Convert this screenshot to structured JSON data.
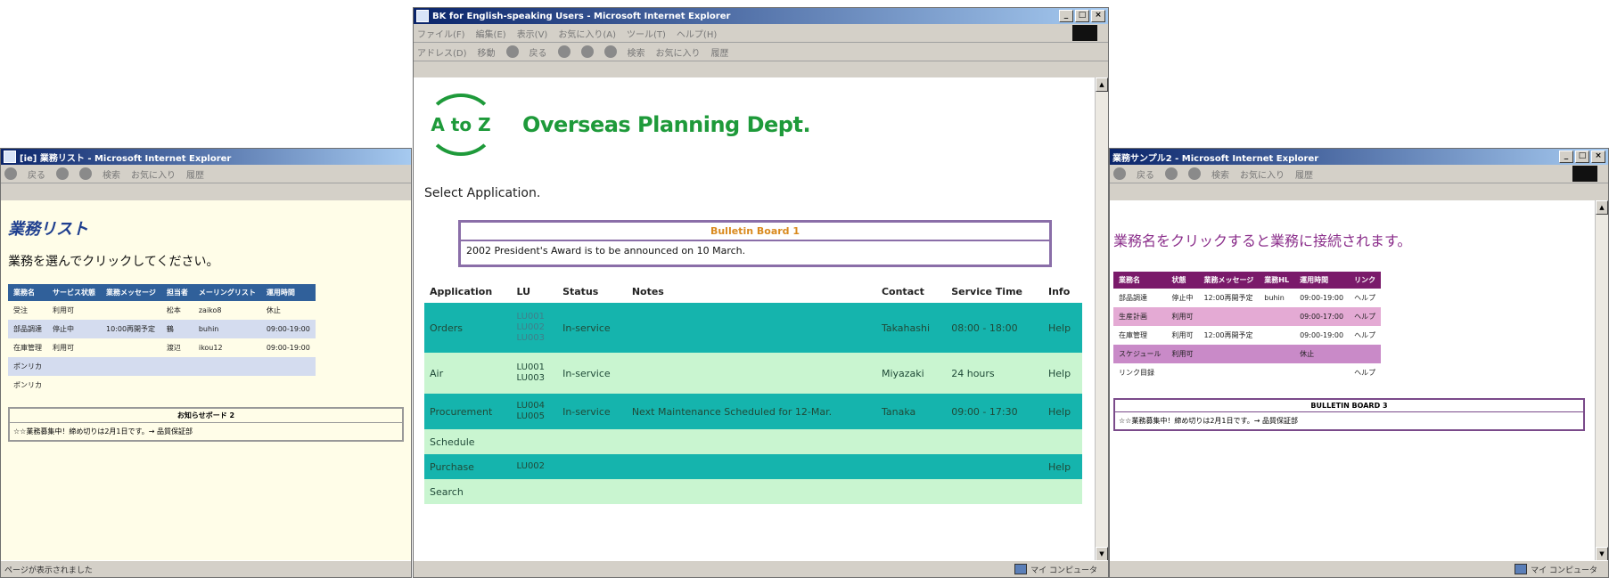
{
  "left": {
    "window_title": "[ie] 業務リスト - Microsoft Internet Explorer",
    "toolbar_back": "戻る",
    "toolbar_search": "検索",
    "toolbar_favorites": "お気に入り",
    "toolbar_history": "履歴",
    "heading": "業務リスト",
    "instruction": "業務を選んでクリックしてください。",
    "headers": [
      "業務名",
      "サービス状態",
      "業務メッセージ",
      "担当者",
      "メーリングリスト",
      "運用時間"
    ],
    "rows": [
      [
        "受注",
        "利用可",
        "",
        "松本",
        "zaiko8",
        "休止"
      ],
      [
        "部品調達",
        "停止中",
        "10:00再開予定",
        "鶴",
        "buhin",
        "09:00-19:00"
      ],
      [
        "在庫管理",
        "利用可",
        "",
        "渡辺",
        "ikou12",
        "09:00-19:00"
      ],
      [
        "ポンリカ",
        "",
        "",
        "",
        "",
        ""
      ],
      [
        "ポンリカ",
        "",
        "",
        "",
        "",
        ""
      ]
    ],
    "bulletin_title": "お知らせボード 2",
    "bulletin_text": "☆☆業務募集中！締め切りは2月1日です。→ 品質保証部",
    "status_text": "ページが表示されました"
  },
  "center": {
    "window_title": "BK for English-speaking Users - Microsoft Internet Explorer",
    "menu": [
      "ファイル(F)",
      "編集(E)",
      "表示(V)",
      "お気に入り(A)",
      "ツール(T)",
      "ヘルプ(H)"
    ],
    "address_label": "アドレス(D)",
    "go_label": "移動",
    "toolbar_back": "戻る",
    "toolbar_search": "検索",
    "toolbar_favorites": "お気に入り",
    "toolbar_history": "履歴",
    "logo_text": "A to Z",
    "dept_title": "Overseas Planning Dept.",
    "select_label": "Select Application.",
    "bulletin_title": "Bulletin Board 1",
    "bulletin_text": "2002 President's Award is to be announced on 10 March.",
    "headers": [
      "Application",
      "LU",
      "Status",
      "Notes",
      "Contact",
      "Service Time",
      "Info"
    ],
    "rows": [
      {
        "app": "Orders",
        "lu": [
          "LU001",
          "LU002",
          "LU003"
        ],
        "status": "In-service",
        "notes": "",
        "contact": "Takahashi",
        "time": "08:00 - 18:00",
        "info": "Help"
      },
      {
        "app": "Air",
        "lu": [
          "LU001",
          "LU003"
        ],
        "status": "In-service",
        "notes": "",
        "contact": "Miyazaki",
        "time": "24 hours",
        "info": "Help"
      },
      {
        "app": "Procurement",
        "lu": [
          "LU004",
          "LU005"
        ],
        "status": "In-service",
        "notes": "Next Maintenance Scheduled for 12-Mar.",
        "contact": "Tanaka",
        "time": "09:00 - 17:30",
        "info": "Help"
      },
      {
        "app": "Schedule",
        "lu": [],
        "status": "",
        "notes": "",
        "contact": "",
        "time": "",
        "info": ""
      },
      {
        "app": "Purchase",
        "lu": [
          "LU002"
        ],
        "status": "",
        "notes": "",
        "contact": "",
        "time": "",
        "info": "Help"
      },
      {
        "app": "Search",
        "lu": [],
        "status": "",
        "notes": "",
        "contact": "",
        "time": "",
        "info": ""
      }
    ],
    "status_zone": "マイ コンピュータ"
  },
  "right": {
    "window_title": "業務サンプル2 - Microsoft Internet Explorer",
    "toolbar_back": "戻る",
    "toolbar_search": "検索",
    "toolbar_favorites": "お気に入り",
    "toolbar_history": "履歴",
    "instruction": "業務名をクリックすると業務に接続されます。",
    "headers": [
      "業務名",
      "状態",
      "業務メッセージ",
      "業務HL",
      "運用時間",
      "リンク"
    ],
    "rows": [
      [
        "部品調達",
        "停止中",
        "12:00再開予定",
        "buhin",
        "09:00-19:00",
        "ヘルプ"
      ],
      [
        "生産計画",
        "利用可",
        "",
        "",
        "09:00-17:00",
        "ヘルプ"
      ],
      [
        "在庫管理",
        "利用可",
        "12:00再開予定",
        "",
        "09:00-19:00",
        "ヘルプ"
      ],
      [
        "スケジュール",
        "利用可",
        "",
        "",
        "休止",
        ""
      ],
      [
        "リンク目録",
        "",
        "",
        "",
        "",
        "ヘルプ"
      ]
    ],
    "bulletin_title": "BULLETIN BOARD 3",
    "bulletin_text": "☆☆業務募集中！締め切りは2月1日です。→ 品質保証部",
    "status_zone": "マイ コンピュータ"
  }
}
